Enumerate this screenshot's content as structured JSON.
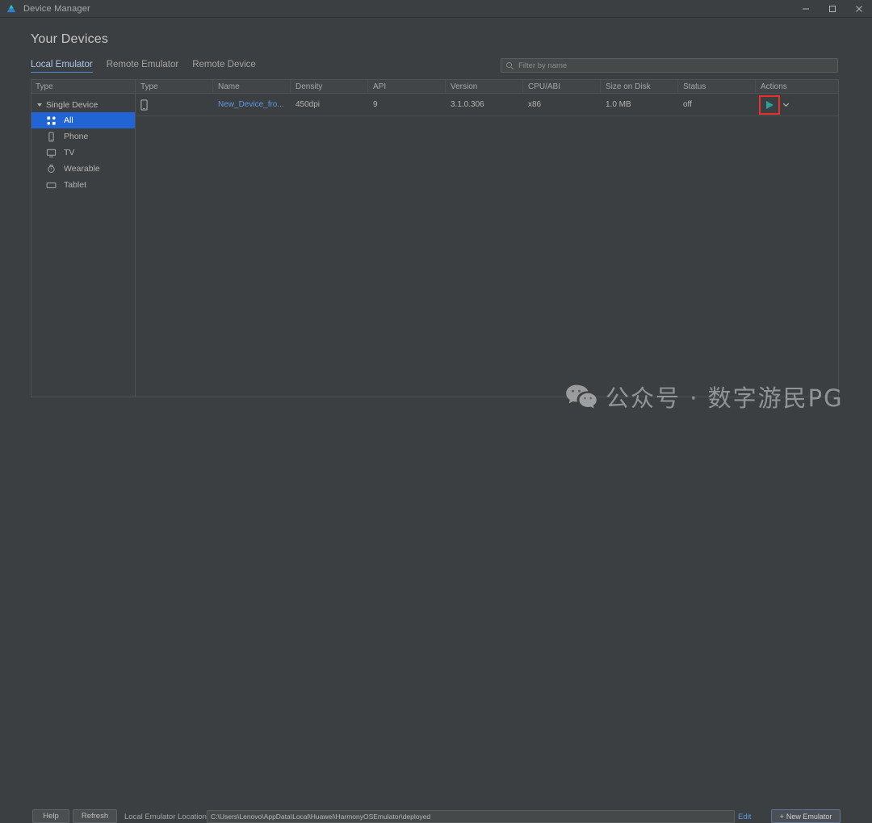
{
  "window": {
    "title": "Device Manager",
    "logo_icon": "deveco-logo-icon",
    "minimize_label": "–",
    "maximize_label": "□",
    "close_label": "×"
  },
  "header": {
    "page_title": "Your Devices",
    "tabs": [
      {
        "label": "Local Emulator",
        "active": true
      },
      {
        "label": "Remote Emulator",
        "active": false
      },
      {
        "label": "Remote Device",
        "active": false
      }
    ]
  },
  "search": {
    "icon": "search-icon",
    "placeholder": "Filter by name",
    "value": ""
  },
  "sidebar": {
    "column_header": "Type",
    "group_label": "Single Device",
    "items": [
      {
        "label": "All",
        "icon": "grid-icon",
        "selected": true
      },
      {
        "label": "Phone",
        "icon": "phone-icon",
        "selected": false
      },
      {
        "label": "TV",
        "icon": "tv-icon",
        "selected": false
      },
      {
        "label": "Wearable",
        "icon": "watch-icon",
        "selected": false
      },
      {
        "label": "Tablet",
        "icon": "tablet-icon",
        "selected": false
      }
    ]
  },
  "table": {
    "columns": [
      "Type",
      "Name",
      "Density",
      "API",
      "Version",
      "CPU/ABI",
      "Size on Disk",
      "Status",
      "Actions"
    ],
    "rows": [
      {
        "type_icon": "phone-icon",
        "name": "New_Device_fro...",
        "density": "450dpi",
        "api": "9",
        "version": "3.1.0.306",
        "cpu_abi": "x86",
        "size_on_disk": "1.0 MB",
        "status": "off",
        "action_play_icon": "play-icon",
        "action_menu_icon": "chevron-down-icon"
      }
    ]
  },
  "footer": {
    "help_label": "Help",
    "refresh_label": "Refresh",
    "location_label": "Local Emulator Location:",
    "location_value": "C:\\Users\\Lenovo\\AppData\\Local\\Huawei\\HarmonyOSEmulator\\deployed",
    "edit_label": "Edit",
    "new_emulator_label": "New Emulator",
    "new_emulator_plus": "+"
  },
  "watermark": {
    "icon": "wechat-icon",
    "text": "公众号 · 数字游民PG"
  },
  "colors": {
    "background": "#3c3f41",
    "panel_header": "#414547",
    "selection_blue": "#2164d4",
    "link_blue": "#5c9ade",
    "play_teal": "#2aa198",
    "highlight_red": "#e5332a"
  }
}
